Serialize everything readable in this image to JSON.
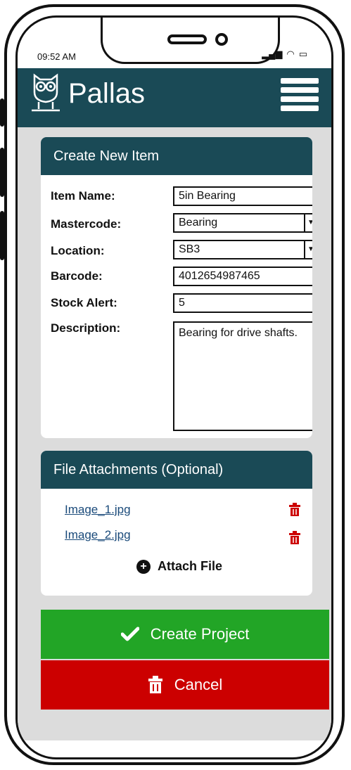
{
  "status_bar": {
    "time": "09:52 AM"
  },
  "app": {
    "title": "Pallas"
  },
  "create_item": {
    "header": "Create New Item",
    "labels": {
      "item_name": "Item Name:",
      "mastercode": "Mastercode:",
      "location": "Location:",
      "barcode": "Barcode:",
      "stock_alert": "Stock Alert:",
      "description": "Description:"
    },
    "values": {
      "item_name": "5in Bearing",
      "mastercode": "Bearing",
      "location": "SB3",
      "barcode": "4012654987465",
      "stock_alert": "5",
      "description": "Bearing for drive shafts."
    }
  },
  "attachments": {
    "header": "File Attachments (Optional)",
    "files": [
      "Image_1.jpg",
      "Image_2.jpg"
    ],
    "attach_label": "Attach File"
  },
  "actions": {
    "create": "Create Project",
    "cancel": "Cancel"
  },
  "colors": {
    "primary": "#1a4a56",
    "success": "#22a526",
    "danger": "#cc0000"
  }
}
